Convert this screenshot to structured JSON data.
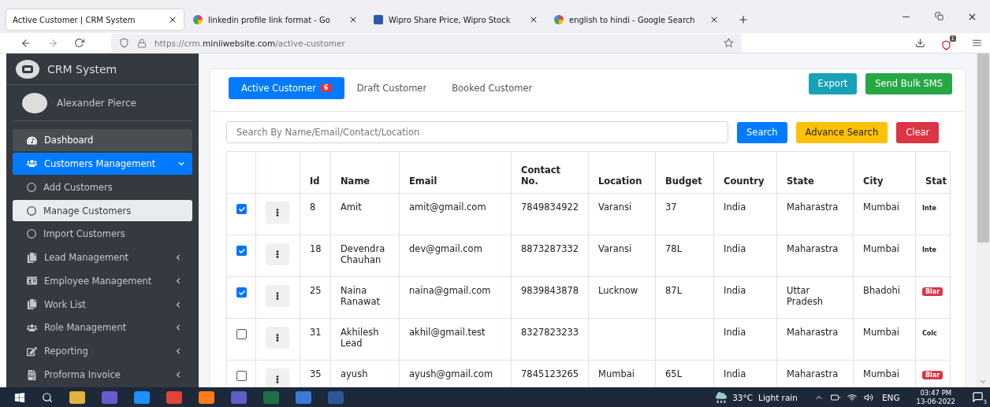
{
  "browser": {
    "tabs": [
      {
        "title": "Active Customer | CRM System",
        "selected": true,
        "kind": "plain"
      },
      {
        "title": "linkedin profile link format - Go",
        "selected": false,
        "kind": "google"
      },
      {
        "title": "Wipro Share Price, Wipro Stock",
        "selected": false,
        "kind": "chart"
      },
      {
        "title": "english to hindi - Google Search",
        "selected": false,
        "kind": "google"
      }
    ],
    "url": {
      "prefix": "https://crm.",
      "domain": "miniiwebsite.com",
      "path": "/active-customer"
    },
    "extension_badge": "1"
  },
  "sidebar": {
    "brand": "CRM System",
    "user": "Alexander Pierce",
    "items": [
      {
        "label": "Dashboard",
        "kind": "nav",
        "selected": false,
        "hovered": true,
        "caret": false
      },
      {
        "label": "Customers Management",
        "kind": "nav",
        "selected": true,
        "hovered": false,
        "caret": true
      },
      {
        "label": "Add Customers",
        "kind": "sub",
        "selected": false,
        "hovered": false,
        "caret": false
      },
      {
        "label": "Manage Customers",
        "kind": "sub",
        "selected": true,
        "hovered": false,
        "caret": false
      },
      {
        "label": "Import Customers",
        "kind": "sub",
        "selected": false,
        "hovered": false,
        "caret": false
      },
      {
        "label": "Lead Management",
        "kind": "nav",
        "selected": false,
        "hovered": false,
        "caret": true
      },
      {
        "label": "Employee Management",
        "kind": "nav",
        "selected": false,
        "hovered": false,
        "caret": true
      },
      {
        "label": "Work List",
        "kind": "nav",
        "selected": false,
        "hovered": false,
        "caret": true
      },
      {
        "label": "Role Management",
        "kind": "nav",
        "selected": false,
        "hovered": false,
        "caret": true
      },
      {
        "label": "Reporting",
        "kind": "nav",
        "selected": false,
        "hovered": false,
        "caret": true
      },
      {
        "label": "Proforma Invoice",
        "kind": "nav",
        "selected": false,
        "hovered": false,
        "caret": true
      }
    ]
  },
  "tabs": [
    {
      "label": "Active Customer",
      "badge": "6",
      "selected": true
    },
    {
      "label": "Draft Customer",
      "selected": false
    },
    {
      "label": "Booked Customer",
      "selected": false
    }
  ],
  "actions": [
    {
      "label": "Export",
      "color": "#17a2b8"
    },
    {
      "label": "Send Bulk SMS",
      "color": "#28a745"
    }
  ],
  "search": {
    "placeholder": "Search By Name/Email/Contact/Location"
  },
  "search_buttons": [
    {
      "label": "Search",
      "color": "#007bff"
    },
    {
      "label": "Advance Search",
      "color": "#ffc107"
    },
    {
      "label": "Clear",
      "color": "#dc3545"
    }
  ],
  "table": {
    "columns": [
      "Id",
      "Name",
      "Email",
      "Contact No.",
      "Location",
      "Budget",
      "Country",
      "State",
      "City",
      "Stat"
    ],
    "rows": [
      {
        "checked": true,
        "cells": [
          "8",
          "Amit",
          "amit@gmail.com",
          "7849834922",
          "Varansi",
          "37",
          "India",
          "Maharastra",
          "Mumbai"
        ],
        "status": {
          "text": "Inte",
          "kind": "text"
        }
      },
      {
        "checked": true,
        "cells": [
          "18",
          "Devendra Chauhan",
          "dev@gmail.com",
          "8873287332",
          "Varansi",
          "78L",
          "India",
          "Maharastra",
          "Mumbai"
        ],
        "status": {
          "text": "Inte",
          "kind": "text"
        }
      },
      {
        "checked": true,
        "cells": [
          "25",
          "Naina Ranawat",
          "naina@gmail.com",
          "9839843878",
          "Lucknow",
          "87L",
          "India",
          "Uttar Pradesh",
          "Bhadohi"
        ],
        "status": {
          "text": "Blar",
          "kind": "badge"
        }
      },
      {
        "checked": false,
        "cells": [
          "31",
          "Akhilesh Lead",
          "akhil@gmail.test",
          "8327823233",
          "",
          "",
          "India",
          "Maharastra",
          "Mumbai"
        ],
        "status": {
          "text": "Colc",
          "kind": "text"
        }
      },
      {
        "checked": false,
        "cells": [
          "35",
          "ayush",
          "ayush@gmail.com",
          "7845123265",
          "Mumbai",
          "65L",
          "India",
          "Maharastra",
          "Mumbai"
        ],
        "status": {
          "text": "Blar",
          "kind": "badge"
        }
      }
    ]
  },
  "taskbar": {
    "weather": "33°C",
    "weather_text": "Light rain",
    "language": "ENG",
    "time": "03:47 PM",
    "date": "13-06-2022",
    "notifications": "3"
  }
}
